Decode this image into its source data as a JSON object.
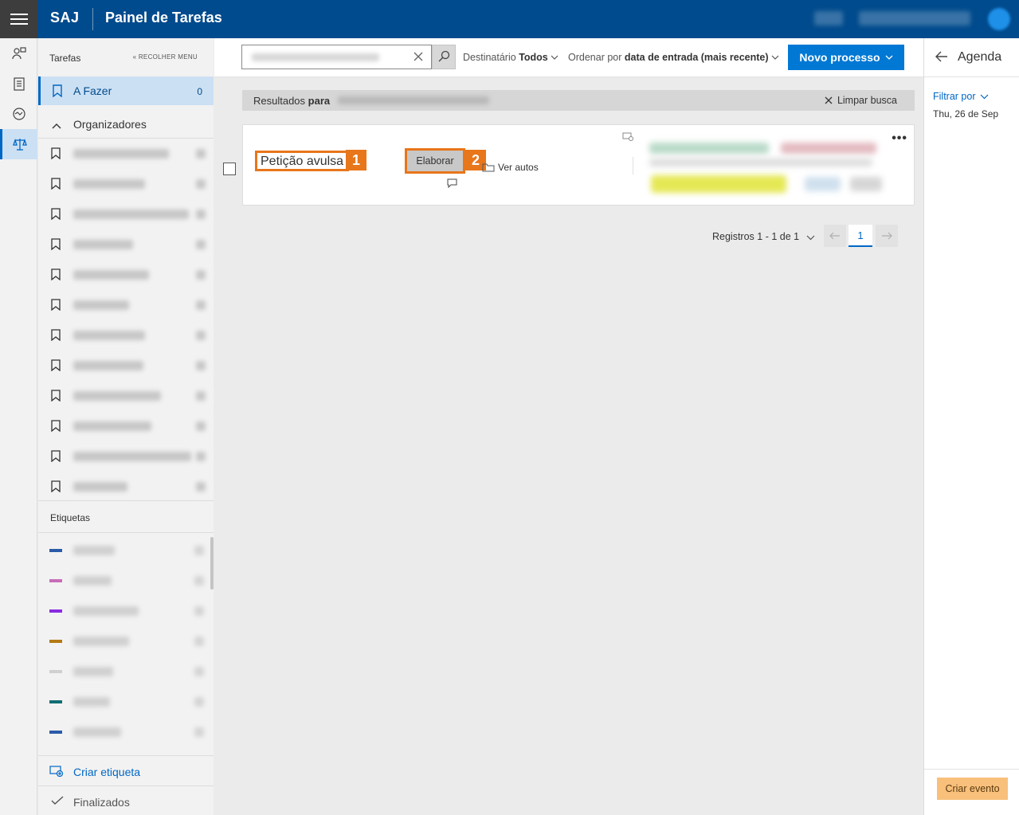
{
  "header": {
    "brand": "SAJ",
    "title": "Painel de Tarefas"
  },
  "sidebar": {
    "title": "Tarefas",
    "collapse_label": "RECOLHER MENU",
    "a_fazer": {
      "label": "A Fazer",
      "count": "0"
    },
    "organizadores_label": "Organizadores",
    "etiquetas_label": "Etiquetas",
    "tag_colors": [
      "#2a5ba8",
      "#c76db7",
      "#8a2be2",
      "#b37a14",
      "#d0d0d0",
      "#0f6e72",
      "#2a5ba8"
    ],
    "criar_etiqueta": "Criar etiqueta",
    "finalizados": "Finalizados"
  },
  "toolbar": {
    "destinatario_label": "Destinatário",
    "destinatario_value": "Todos",
    "ordenar_label": "Ordenar por",
    "ordenar_value": "data de entrada (mais recente)",
    "novo_processo": "Novo processo"
  },
  "results": {
    "prefix": "Resultados",
    "para": "para",
    "clear": "Limpar busca"
  },
  "task": {
    "title": "Petição avulsa",
    "badge1": "1",
    "action": "Elaborar",
    "badge2": "2",
    "ver_autos": "Ver autos",
    "menu": "•••"
  },
  "pagination": {
    "summary": "Registros 1 - 1 de 1",
    "current_page": "1"
  },
  "agenda": {
    "title": "Agenda",
    "filter_label": "Filtrar por",
    "date": "Thu, 26 de Sep",
    "create_event": "Criar evento"
  },
  "colors": {
    "topbar": "#004b8d",
    "accent": "#0078d4",
    "highlight": "#e8761a"
  }
}
